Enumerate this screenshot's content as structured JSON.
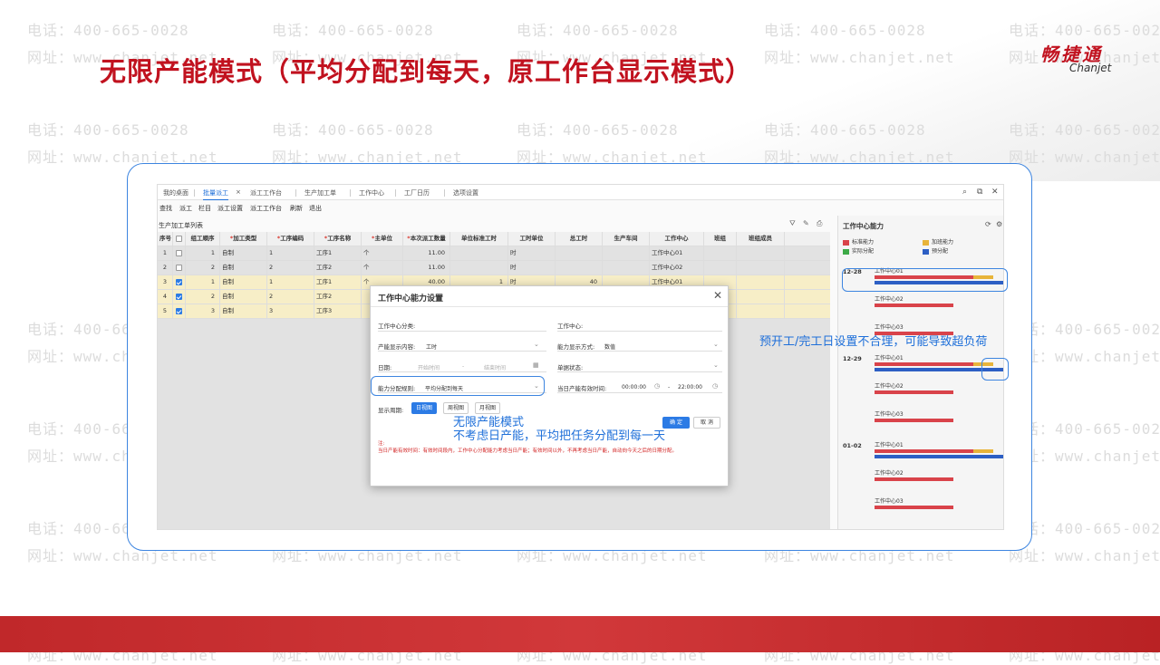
{
  "slide": {
    "title": "无限产能模式（平均分配到每天，原工作台显示模式）",
    "logo_cn": "畅捷通",
    "logo_en": "Chanjet"
  },
  "watermark": {
    "phone": "电话：400-665-0028",
    "site": "网址：www.chanjet.net"
  },
  "app": {
    "tabs": [
      {
        "label": "我的桌面",
        "active": false
      },
      {
        "label": "批量派工",
        "active": true
      },
      {
        "label": "派工工作台",
        "active": false
      },
      {
        "label": "生产加工单",
        "active": false
      },
      {
        "label": "工作中心",
        "active": false
      },
      {
        "label": "工厂日历",
        "active": false
      },
      {
        "label": "选项设置",
        "active": false
      }
    ],
    "window_icons": [
      "search-icon",
      "restore-icon",
      "close-icon"
    ],
    "toolbar": [
      "查找",
      "派工",
      "栏目",
      "派工设置",
      "派工工作台",
      "刷新",
      "退出"
    ],
    "list_title": "生产加工单列表",
    "columns": [
      {
        "label": "序号",
        "required": false
      },
      {
        "label": "",
        "required": false
      },
      {
        "label": "组工顺序",
        "required": false
      },
      {
        "label": "加工类型",
        "required": true
      },
      {
        "label": "工序编码",
        "required": true
      },
      {
        "label": "工序名称",
        "required": true
      },
      {
        "label": "主单位",
        "required": true
      },
      {
        "label": "本次派工数量",
        "required": true
      },
      {
        "label": "单位标准工时",
        "required": false
      },
      {
        "label": "工时单位",
        "required": false
      },
      {
        "label": "总工时",
        "required": false
      },
      {
        "label": "生产车间",
        "required": false
      },
      {
        "label": "工作中心",
        "required": false
      },
      {
        "label": "班组",
        "required": false
      },
      {
        "label": "班组成员",
        "required": false
      }
    ],
    "rows": [
      {
        "no": "1",
        "checked": false,
        "seq": "1",
        "type": "自制",
        "code": "1",
        "name": "工序1",
        "unit": "个",
        "qty": "11.00",
        "std": "",
        "tunit": "时",
        "total": "",
        "shop": "",
        "wc": "工作中心01",
        "team": "",
        "member": ""
      },
      {
        "no": "2",
        "checked": false,
        "seq": "2",
        "type": "自制",
        "code": "2",
        "name": "工序2",
        "unit": "个",
        "qty": "11.00",
        "std": "",
        "tunit": "时",
        "total": "",
        "shop": "",
        "wc": "工作中心02",
        "team": "",
        "member": ""
      },
      {
        "no": "3",
        "checked": true,
        "seq": "1",
        "type": "自制",
        "code": "1",
        "name": "工序1",
        "unit": "个",
        "qty": "40.00",
        "std": "1",
        "tunit": "时",
        "total": "40",
        "shop": "",
        "wc": "工作中心01",
        "team": "",
        "member": ""
      },
      {
        "no": "4",
        "checked": true,
        "seq": "2",
        "type": "自制",
        "code": "2",
        "name": "工序2",
        "unit": "",
        "qty": "",
        "std": "",
        "tunit": "",
        "total": "",
        "shop": "",
        "wc": "",
        "team": "",
        "member": ""
      },
      {
        "no": "5",
        "checked": true,
        "seq": "3",
        "type": "自制",
        "code": "3",
        "name": "工序3",
        "unit": "",
        "qty": "",
        "std": "",
        "tunit": "",
        "total": "",
        "shop": "",
        "wc": "",
        "team": "",
        "member": ""
      }
    ],
    "capacity": {
      "title": "工作中心能力",
      "legend": [
        {
          "label": "标准能力",
          "color": "#d9434a"
        },
        {
          "label": "加班能力",
          "color": "#e8b43a"
        },
        {
          "label": "实际分配",
          "color": "#3daa47"
        },
        {
          "label": "预分配",
          "color": "#2d5fc4"
        }
      ],
      "days": [
        {
          "date": "12-28",
          "centers": [
            {
              "name": "工作中心01",
              "standard": 0.75,
              "overtime": 0.15,
              "prealloc": 1.0
            },
            {
              "name": "工作中心02",
              "standard": 0.6,
              "overtime": 0,
              "prealloc": 0
            },
            {
              "name": "工作中心03",
              "standard": 0.6,
              "overtime": 0,
              "prealloc": 0
            }
          ]
        },
        {
          "date": "12-29",
          "centers": [
            {
              "name": "工作中心01",
              "standard": 0.75,
              "overtime": 0.15,
              "prealloc": 1.0
            },
            {
              "name": "工作中心02",
              "standard": 0.6,
              "overtime": 0,
              "prealloc": 0
            },
            {
              "name": "工作中心03",
              "standard": 0.6,
              "overtime": 0,
              "prealloc": 0
            }
          ]
        },
        {
          "date": "01-02",
          "centers": [
            {
              "name": "工作中心01",
              "standard": 0.75,
              "overtime": 0.15,
              "prealloc": 1.0
            },
            {
              "name": "工作中心02",
              "standard": 0.6,
              "overtime": 0,
              "prealloc": 0
            },
            {
              "name": "工作中心03",
              "standard": 0.6,
              "overtime": 0,
              "prealloc": 0
            }
          ]
        }
      ]
    }
  },
  "dialog": {
    "title": "工作中心能力设置",
    "wc_category_label": "工作中心分类:",
    "wc_label": "工作中心:",
    "capacity_display_label": "产能显示内容:",
    "capacity_display_value": "工时",
    "capacity_mode_label": "能力显示方式:",
    "capacity_mode_value": "数值",
    "date_label": "日期:",
    "date_start_placeholder": "开始时间",
    "date_sep": "-",
    "date_end_placeholder": "结束时间",
    "doc_status_label": "单据状态:",
    "alloc_rule_label": "能力分配规则:",
    "alloc_rule_value": "平均分配到每天",
    "daily_time_label": "当日产能有效时间:",
    "daily_time_start": "00:00:00",
    "daily_time_sep": "-",
    "daily_time_end": "22:00:00",
    "period_label": "显示周期:",
    "period_buttons": [
      {
        "label": "日视图",
        "active": true
      },
      {
        "label": "周视图",
        "active": false
      },
      {
        "label": "月视图",
        "active": false
      }
    ],
    "confirm_label": "确 定",
    "cancel_label": "取 消",
    "note_title": "注:",
    "note_text": "当日产能有效时间：有效时间段内，工作中心分配能力考虑当日产能；有效时间以外，不再考虑当日产能，自动向今天之后的日期分配。"
  },
  "annotations": {
    "infinite_title": "无限产能模式",
    "infinite_desc": "不考虑日产能，平均把任务分配到每一天",
    "overload_warning": "预开工/完工日设置不合理，可能导致超负荷"
  }
}
